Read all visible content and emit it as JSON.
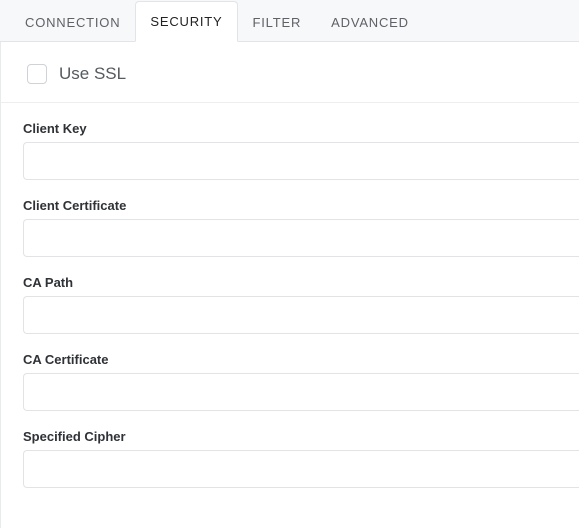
{
  "tabs": {
    "connection": "CONNECTION",
    "security": "SECURITY",
    "filter": "FILTER",
    "advanced": "ADVANCED"
  },
  "security": {
    "use_ssl_label": "Use SSL",
    "use_ssl_checked": false,
    "fields": {
      "client_key": {
        "label": "Client Key",
        "value": ""
      },
      "client_certificate": {
        "label": "Client Certificate",
        "value": ""
      },
      "ca_path": {
        "label": "CA Path",
        "value": ""
      },
      "ca_certificate": {
        "label": "CA Certificate",
        "value": ""
      },
      "specified_cipher": {
        "label": "Specified Cipher",
        "value": ""
      }
    }
  }
}
